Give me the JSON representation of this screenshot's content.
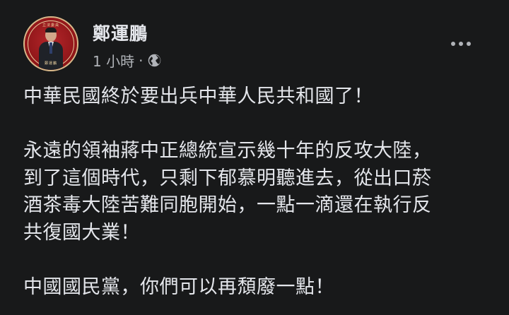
{
  "post": {
    "author": "鄭運鵬",
    "time": "1 小時",
    "separator": "·",
    "privacy_icon": "globe-icon",
    "more_icon": "more-options-icon",
    "avatar": {
      "top_text": "立法委員",
      "bottom_text": "鄭運鵬"
    },
    "paragraphs": [
      [
        "中華民國終於要出兵中華人民共和國了！"
      ],
      [
        "永遠的領袖蔣中正總統宣示幾十年的反攻大陸，",
        "到了這個時代，只剩下郁慕明聽進去，從出口菸",
        "酒茶毒大陸苦難同胞開始，一點一滴還在執行反",
        "共復國大業！"
      ],
      [
        "中國國民黨，你們可以再頹廢一點！"
      ]
    ]
  },
  "colors": {
    "background": "#18191a",
    "text_primary": "#e4e6eb",
    "text_secondary": "#b0b3b8",
    "avatar_red": "#8e1518",
    "avatar_gold": "#d9b98a"
  }
}
